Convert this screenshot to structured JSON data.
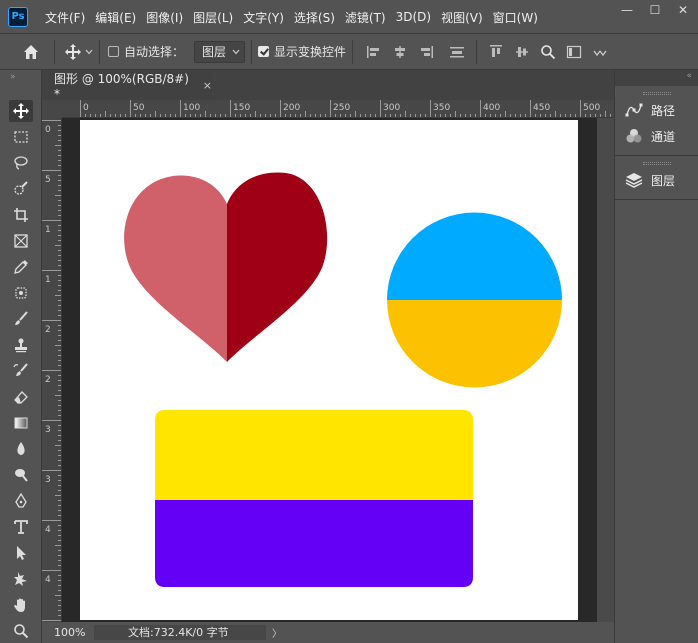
{
  "app": {
    "logo": "Ps",
    "menu": [
      "文件(F)",
      "编辑(E)",
      "图像(I)",
      "图层(L)",
      "文字(Y)",
      "选择(S)",
      "滤镜(T)",
      "3D(D)",
      "视图(V)",
      "窗口(W)"
    ],
    "window_controls": {
      "minimize": "—",
      "maximize": "☐",
      "close": "✕"
    }
  },
  "options_bar": {
    "auto_select_label": "自动选择：",
    "auto_select_checked": false,
    "layer_select_value": "图层",
    "show_transform_label": "显示变换控件",
    "show_transform_checked": true
  },
  "document": {
    "tab_title": "图形 @ 100%(RGB/8#) *",
    "close_glyph": "×",
    "ruler_h_labels": [
      "0",
      "50",
      "100",
      "150",
      "200",
      "250",
      "300",
      "350",
      "400",
      "450",
      "500"
    ],
    "ruler_v_labels": [
      "0",
      "5",
      "1",
      "1",
      "2",
      "2",
      "3",
      "3",
      "4",
      "4"
    ],
    "colors": {
      "heart_left": "#d0606a",
      "heart_right": "#a00016",
      "circle_top": "#00aaff",
      "circle_bottom": "#fcc100",
      "rect_top": "#ffe500",
      "rect_bottom": "#6400f5",
      "canvas": "#ffffff"
    }
  },
  "status_bar": {
    "zoom": "100%",
    "doc_info": "文档:732.4K/0 字节",
    "arrow": "〉"
  },
  "panels": {
    "items": [
      {
        "label": "路径",
        "icon": "paths-icon"
      },
      {
        "label": "通道",
        "icon": "channels-icon"
      },
      {
        "label": "图层",
        "icon": "layers-icon"
      }
    ]
  }
}
